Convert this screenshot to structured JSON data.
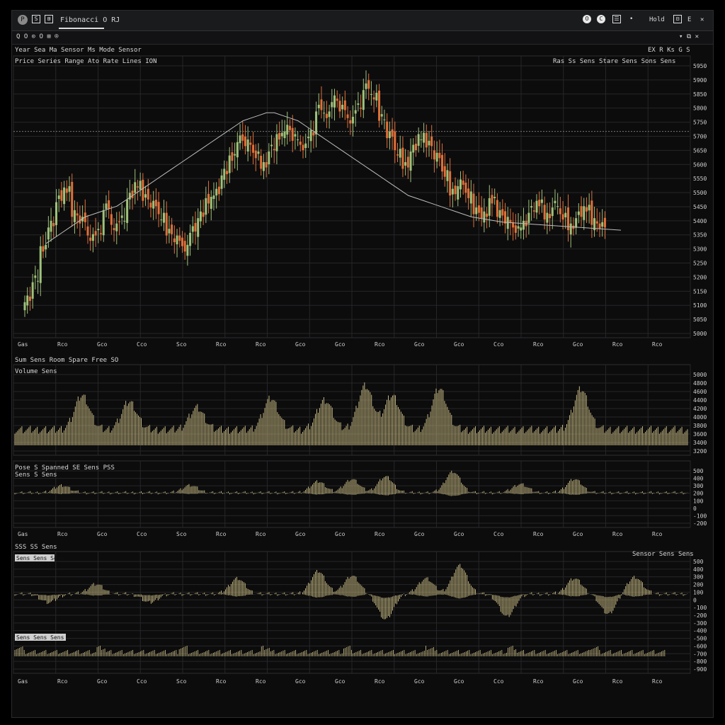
{
  "window": {
    "title": "Fibonacci O RJ",
    "toolbar_left": "Q  O  ⊙  O  ⊞  ⌾",
    "toolbar_right": "▾  ⧉  ✕",
    "controls": [
      "O",
      "C",
      "☰",
      "•",
      "Hold",
      "⊟",
      "E",
      "✕"
    ],
    "colors": {
      "bg": "#0c0c0d",
      "up": "#9fc27a",
      "down": "#e0703a",
      "bar": "#d8c98c",
      "grid": "#262628",
      "ma": "#bdbdbd"
    }
  },
  "panels": [
    {
      "id": "price",
      "title": "Year Sea Ma Sensor Ms Mode Sensor",
      "subtitle": "Price Series Range Ato Rate Lines ION",
      "right_top": "EX R Ks G S",
      "right_sub": "Ras Ss Sens Stare Sens Sons Sens"
    },
    {
      "id": "volume",
      "title": "Sum Sens Room Spare Free SO",
      "subtitle": "Volume Sens"
    },
    {
      "id": "osc1",
      "title": "Pose S Spanned SE Sens PSS",
      "subtitle": "Sens S Sens"
    },
    {
      "id": "osc2",
      "title": "SSS SS Sens",
      "legend_a": "Sens Sens Sens",
      "legend_b": "Sens Sens Sens",
      "legend_c": "Sensor Sens Sens"
    }
  ],
  "chart_data": [
    {
      "type": "candlestick",
      "panel": "price",
      "x_ticks": [
        "Gas",
        "Rco",
        "Gco",
        "Cco",
        "Sco",
        "Rco",
        "Rco",
        "Gco",
        "Gco",
        "Rco",
        "Gco",
        "Gco",
        "Cco",
        "Rco",
        "Gco",
        "Rco",
        "Rco"
      ],
      "y_ticks": [
        "5950",
        "5900",
        "5850",
        "5800",
        "5750",
        "5700",
        "5650",
        "5600",
        "5550",
        "5500",
        "5450",
        "5400",
        "5350",
        "5300",
        "5250",
        "5200",
        "5150",
        "5100",
        "5050",
        "5000"
      ],
      "ylim": [
        5000,
        5950
      ],
      "reference_line": 5720,
      "close": [
        5100,
        5160,
        5280,
        5380,
        5460,
        5500,
        5420,
        5380,
        5320,
        5350,
        5430,
        5360,
        5400,
        5470,
        5520,
        5480,
        5440,
        5400,
        5350,
        5310,
        5280,
        5360,
        5400,
        5460,
        5500,
        5560,
        5620,
        5700,
        5670,
        5630,
        5600,
        5650,
        5700,
        5740,
        5690,
        5660,
        5720,
        5800,
        5780,
        5850,
        5800,
        5760,
        5820,
        5880,
        5850,
        5780,
        5700,
        5640,
        5600,
        5650,
        5700,
        5680,
        5620,
        5560,
        5500,
        5520,
        5480,
        5430,
        5400,
        5460,
        5420,
        5380,
        5350,
        5380,
        5420,
        5450,
        5410,
        5440,
        5400,
        5370,
        5400,
        5430,
        5390,
        5360
      ],
      "ma": [
        5300,
        5320,
        5340,
        5360,
        5380,
        5400,
        5410,
        5420,
        5430,
        5440,
        5460,
        5480,
        5500,
        5520,
        5540,
        5560,
        5580,
        5600,
        5620,
        5640,
        5660,
        5680,
        5700,
        5720,
        5740,
        5760,
        5770,
        5780,
        5790,
        5790,
        5780,
        5770,
        5760,
        5740,
        5720,
        5700,
        5680,
        5660,
        5640,
        5620,
        5600,
        5580,
        5560,
        5540,
        5520,
        5500,
        5480,
        5470,
        5460,
        5450,
        5440,
        5430,
        5420,
        5410,
        5400,
        5395,
        5390,
        5385,
        5380,
        5378,
        5376,
        5374,
        5372,
        5370,
        5368,
        5366,
        5364,
        5362,
        5360,
        5358,
        5356,
        5354,
        5352,
        5350
      ]
    },
    {
      "type": "bar",
      "panel": "volume",
      "y_ticks": [
        "5000",
        "4800",
        "4600",
        "4400",
        "4200",
        "4000",
        "3800",
        "3600",
        "3400",
        "3200"
      ],
      "baseline": 0.25,
      "peaks": [
        [
          0.1,
          0.55
        ],
        [
          0.17,
          0.45
        ],
        [
          0.27,
          0.35
        ],
        [
          0.38,
          0.5
        ],
        [
          0.46,
          0.48
        ],
        [
          0.52,
          0.7
        ],
        [
          0.56,
          0.55
        ],
        [
          0.63,
          0.66
        ],
        [
          0.84,
          0.65
        ]
      ]
    },
    {
      "type": "bar",
      "panel": "osc1",
      "y_ticks": [
        "500",
        "400",
        "300",
        "200",
        "100",
        "0",
        "-100",
        "-200"
      ],
      "x_ticks": [
        "Gas",
        "Rco",
        "Gco",
        "Cco",
        "Sco",
        "Rco",
        "Rco",
        "Gco",
        "Gco",
        "Rco",
        "Gco",
        "Gco",
        "Cco",
        "Rco",
        "Gco",
        "Rco",
        "Rco"
      ],
      "peaks": [
        [
          0.07,
          0.3
        ],
        [
          0.26,
          0.3
        ],
        [
          0.45,
          0.45
        ],
        [
          0.5,
          0.55
        ],
        [
          0.55,
          0.65
        ],
        [
          0.65,
          0.85
        ],
        [
          0.75,
          0.35
        ],
        [
          0.83,
          0.55
        ]
      ]
    },
    {
      "type": "bar",
      "panel": "osc2",
      "y_ticks": [
        "500",
        "400",
        "300",
        "200",
        "100",
        "0",
        "-100",
        "-200",
        "-300",
        "-400",
        "-500",
        "-600",
        "-700",
        "-800",
        "-900"
      ],
      "x_ticks": [
        "Gas",
        "Rco",
        "Gco",
        "Cco",
        "Sco",
        "Rco",
        "Rco",
        "Gco",
        "Gco",
        "Rco",
        "Gco",
        "Gco",
        "Cco",
        "Rco",
        "Gco",
        "Rco",
        "Rco"
      ],
      "peaks": [
        [
          0.05,
          -0.3
        ],
        [
          0.12,
          0.35
        ],
        [
          0.2,
          -0.3
        ],
        [
          0.33,
          0.55
        ],
        [
          0.45,
          0.8
        ],
        [
          0.5,
          0.65
        ],
        [
          0.55,
          -0.9
        ],
        [
          0.61,
          0.55
        ],
        [
          0.66,
          1.0
        ],
        [
          0.73,
          -0.8
        ],
        [
          0.83,
          0.55
        ],
        [
          0.88,
          -0.7
        ],
        [
          0.92,
          0.6
        ]
      ]
    }
  ]
}
